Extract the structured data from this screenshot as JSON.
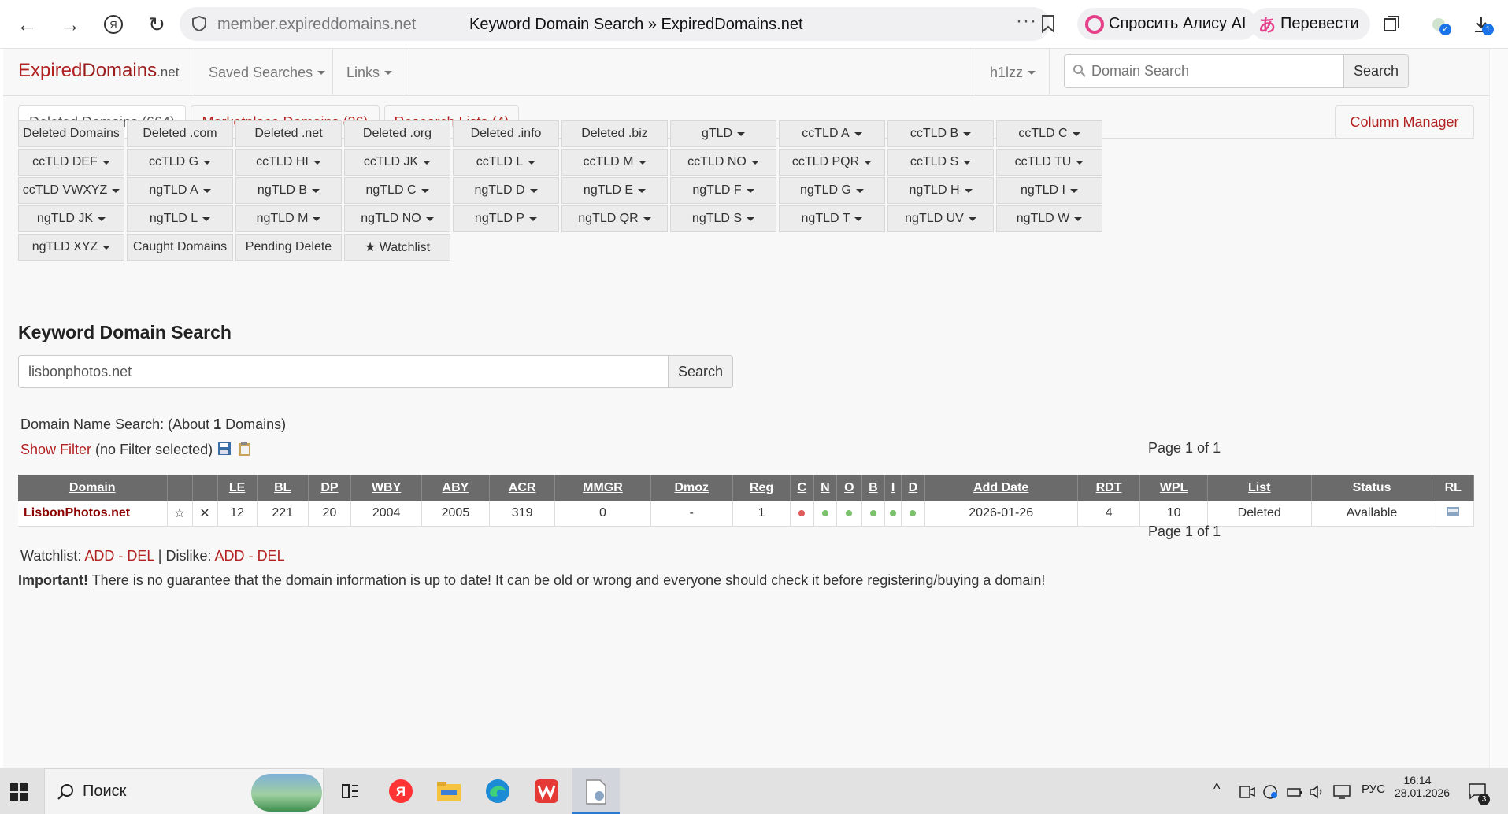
{
  "browser": {
    "url": "member.expireddomains.net",
    "title": "Keyword Domain Search » ExpiredDomains.net",
    "alice_label": "Спросить Алису AI",
    "translate_label": "Перевести",
    "downloads_badge": "1"
  },
  "site": {
    "logo_main": "Expired",
    "logo_domains": "Domains",
    "logo_tld": ".net",
    "nav": {
      "saved_searches": "Saved Searches",
      "links": "Links",
      "user": "h1lzz"
    },
    "search": {
      "placeholder": "Domain Search",
      "button": "Search"
    },
    "tabs": [
      {
        "label": "Deleted Domains (664)"
      },
      {
        "label": "Marketplace Domains (26)"
      },
      {
        "label": "Research Lists (4)"
      }
    ],
    "column_manager": "Column Manager",
    "grid": [
      [
        "Deleted Domains",
        "Deleted .com",
        "Deleted .net",
        "Deleted .org",
        "Deleted .info",
        "Deleted .biz",
        "gTLD",
        "ccTLD A",
        "ccTLD B",
        "ccTLD C"
      ],
      [
        "ccTLD DEF",
        "ccTLD G",
        "ccTLD HI",
        "ccTLD JK",
        "ccTLD L",
        "ccTLD M",
        "ccTLD NO",
        "ccTLD PQR",
        "ccTLD S",
        "ccTLD TU"
      ],
      [
        "ccTLD VWXYZ",
        "ngTLD A",
        "ngTLD B",
        "ngTLD C",
        "ngTLD D",
        "ngTLD E",
        "ngTLD F",
        "ngTLD G",
        "ngTLD H",
        "ngTLD I"
      ],
      [
        "ngTLD JK",
        "ngTLD L",
        "ngTLD M",
        "ngTLD NO",
        "ngTLD P",
        "ngTLD QR",
        "ngTLD S",
        "ngTLD T",
        "ngTLD UV",
        "ngTLD W"
      ],
      [
        "ngTLD XYZ",
        "Caught Domains",
        "Pending Delete",
        "★ Watchlist"
      ]
    ],
    "heading": "Keyword Domain Search",
    "keyword_value": "lisbonphotos.net",
    "keyword_button": "Search",
    "result_prefix": "Domain Name Search: (About ",
    "result_count": "1",
    "result_suffix": " Domains)",
    "show_filter": "Show Filter",
    "filter_note": "(no Filter selected)",
    "page_info": "Page 1 of 1",
    "table": {
      "headers": [
        "Domain",
        "",
        "",
        "LE",
        "BL",
        "DP",
        "WBY",
        "ABY",
        "ACR",
        "MMGR",
        "Dmoz",
        "Reg",
        "C",
        "N",
        "O",
        "B",
        "I",
        "D",
        "Add Date",
        "RDT",
        "WPL",
        "List",
        "Status",
        "RL"
      ],
      "row": {
        "domain": "LisbonPhotos.net",
        "le": "12",
        "bl": "221",
        "dp": "20",
        "wby": "2004",
        "aby": "2005",
        "acr": "319",
        "mmgr": "0",
        "dmoz": "-",
        "reg": "1",
        "add_date": "2026-01-26",
        "rdt": "4",
        "wpl": "10",
        "list": "Deleted",
        "status": "Available"
      }
    },
    "watchlist_label": "Watchlist:",
    "add": "ADD",
    "del": "DEL",
    "dislike_label": "Dislike:",
    "important": "Important!",
    "disclaimer": "There is no guarantee that the domain information is up to date! It can be old or wrong and everyone should check it before registering/buying a domain!"
  },
  "taskbar": {
    "search_label": "Поиск",
    "lang": "РУС",
    "time": "16:14",
    "date": "28.01.2026",
    "notif_count": "3"
  },
  "colors": {
    "brand_red": "#b22222",
    "table_header": "#6b6b6b",
    "available_green": "#3aa53a"
  }
}
